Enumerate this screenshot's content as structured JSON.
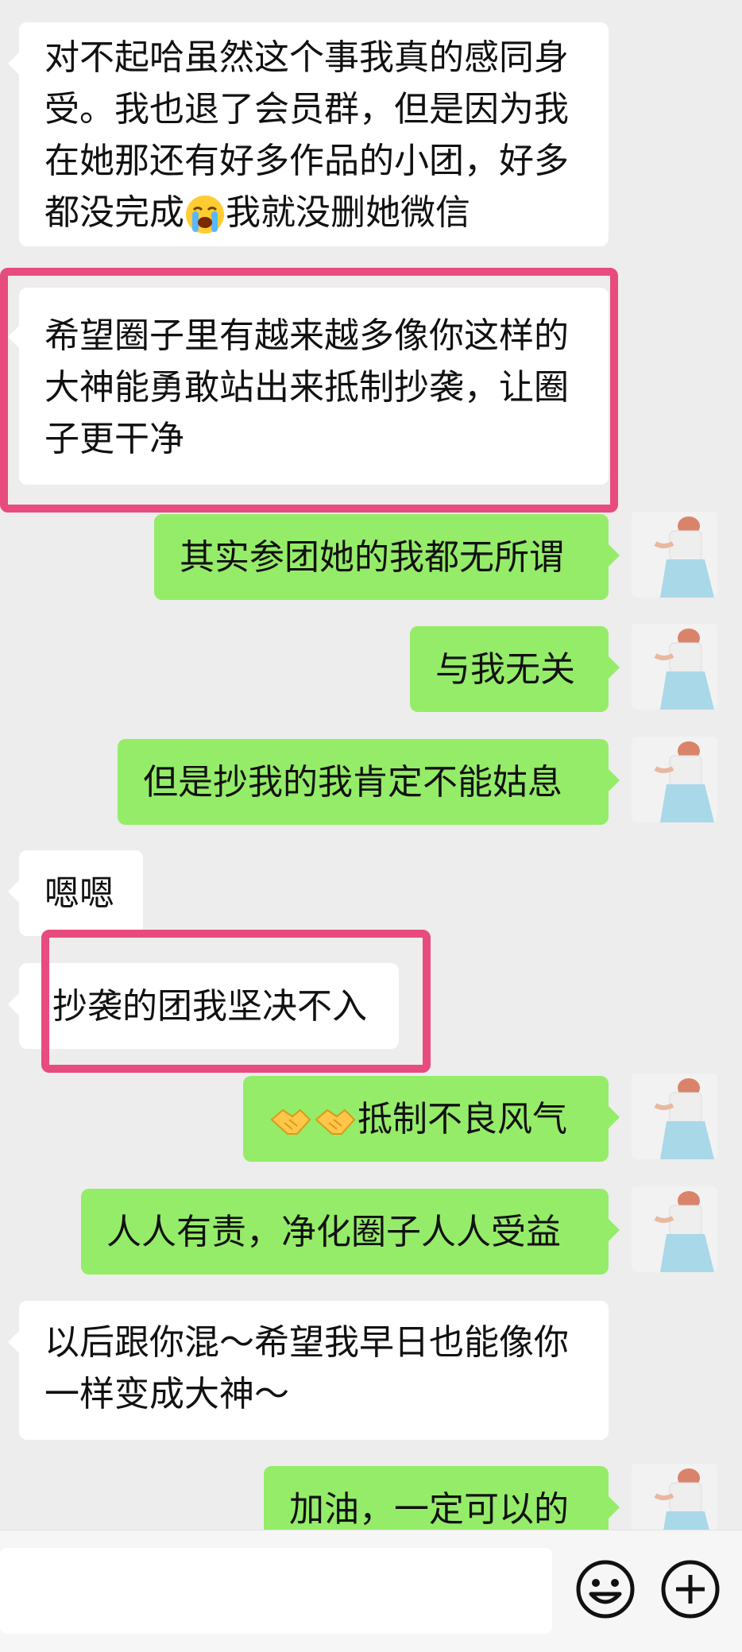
{
  "messages": [
    {
      "side": "left",
      "text": "对不起哈虽然这个事我真的感同身受。我也退了会员群，但是因为我在她那还有好多作品的小团，好多都没完成😭我就没删她微信"
    },
    {
      "side": "left",
      "text": "希望圈子里有越来越多像你这样的大神能勇敢站出来抵制抄袭，让圈子更干净"
    },
    {
      "side": "right",
      "text": "其实参团她的我都无所谓"
    },
    {
      "side": "right",
      "text": "与我无关"
    },
    {
      "side": "right",
      "text": "但是抄我的我肯定不能姑息"
    },
    {
      "side": "left",
      "text": "嗯嗯"
    },
    {
      "side": "left",
      "text": "抄袭的团我坚决不入"
    },
    {
      "side": "right",
      "text": "🤝🤝抵制不良风气"
    },
    {
      "side": "right",
      "text": "人人有责，净化圈子人人受益"
    },
    {
      "side": "left",
      "text": "以后跟你混～希望我早日也能像你一样变成大神～"
    },
    {
      "side": "right",
      "text": "加油，一定可以的"
    }
  ],
  "display_lines": {
    "m0": [
      "对不起哈虽然这个事我真的感同身",
      "受。我也退了会员群，但是因为我",
      "在她那还有好多作品的小团，好多",
      "都没完成",
      "我就没删她微信"
    ],
    "m1": [
      "希望圈子里有越来越多像你这样的",
      "大神能勇敢站出来抵制抄袭，让圈",
      "子更干净"
    ],
    "m7": [
      "抵制不良风气"
    ],
    "m9": [
      "以后跟你混～希望我早日也能像你",
      "一样变成大神～"
    ]
  },
  "icons": {
    "cry_emoji": "loudly-crying-face-emoji",
    "handshake_emoji": "handshake-emoji",
    "emoji_button": "smiley-face-icon",
    "more_button": "plus-circle-icon"
  },
  "colors": {
    "highlight": "#e84b7d",
    "bubble_right": "#95ec69",
    "bubble_left": "#ffffff",
    "background": "#ededed"
  }
}
